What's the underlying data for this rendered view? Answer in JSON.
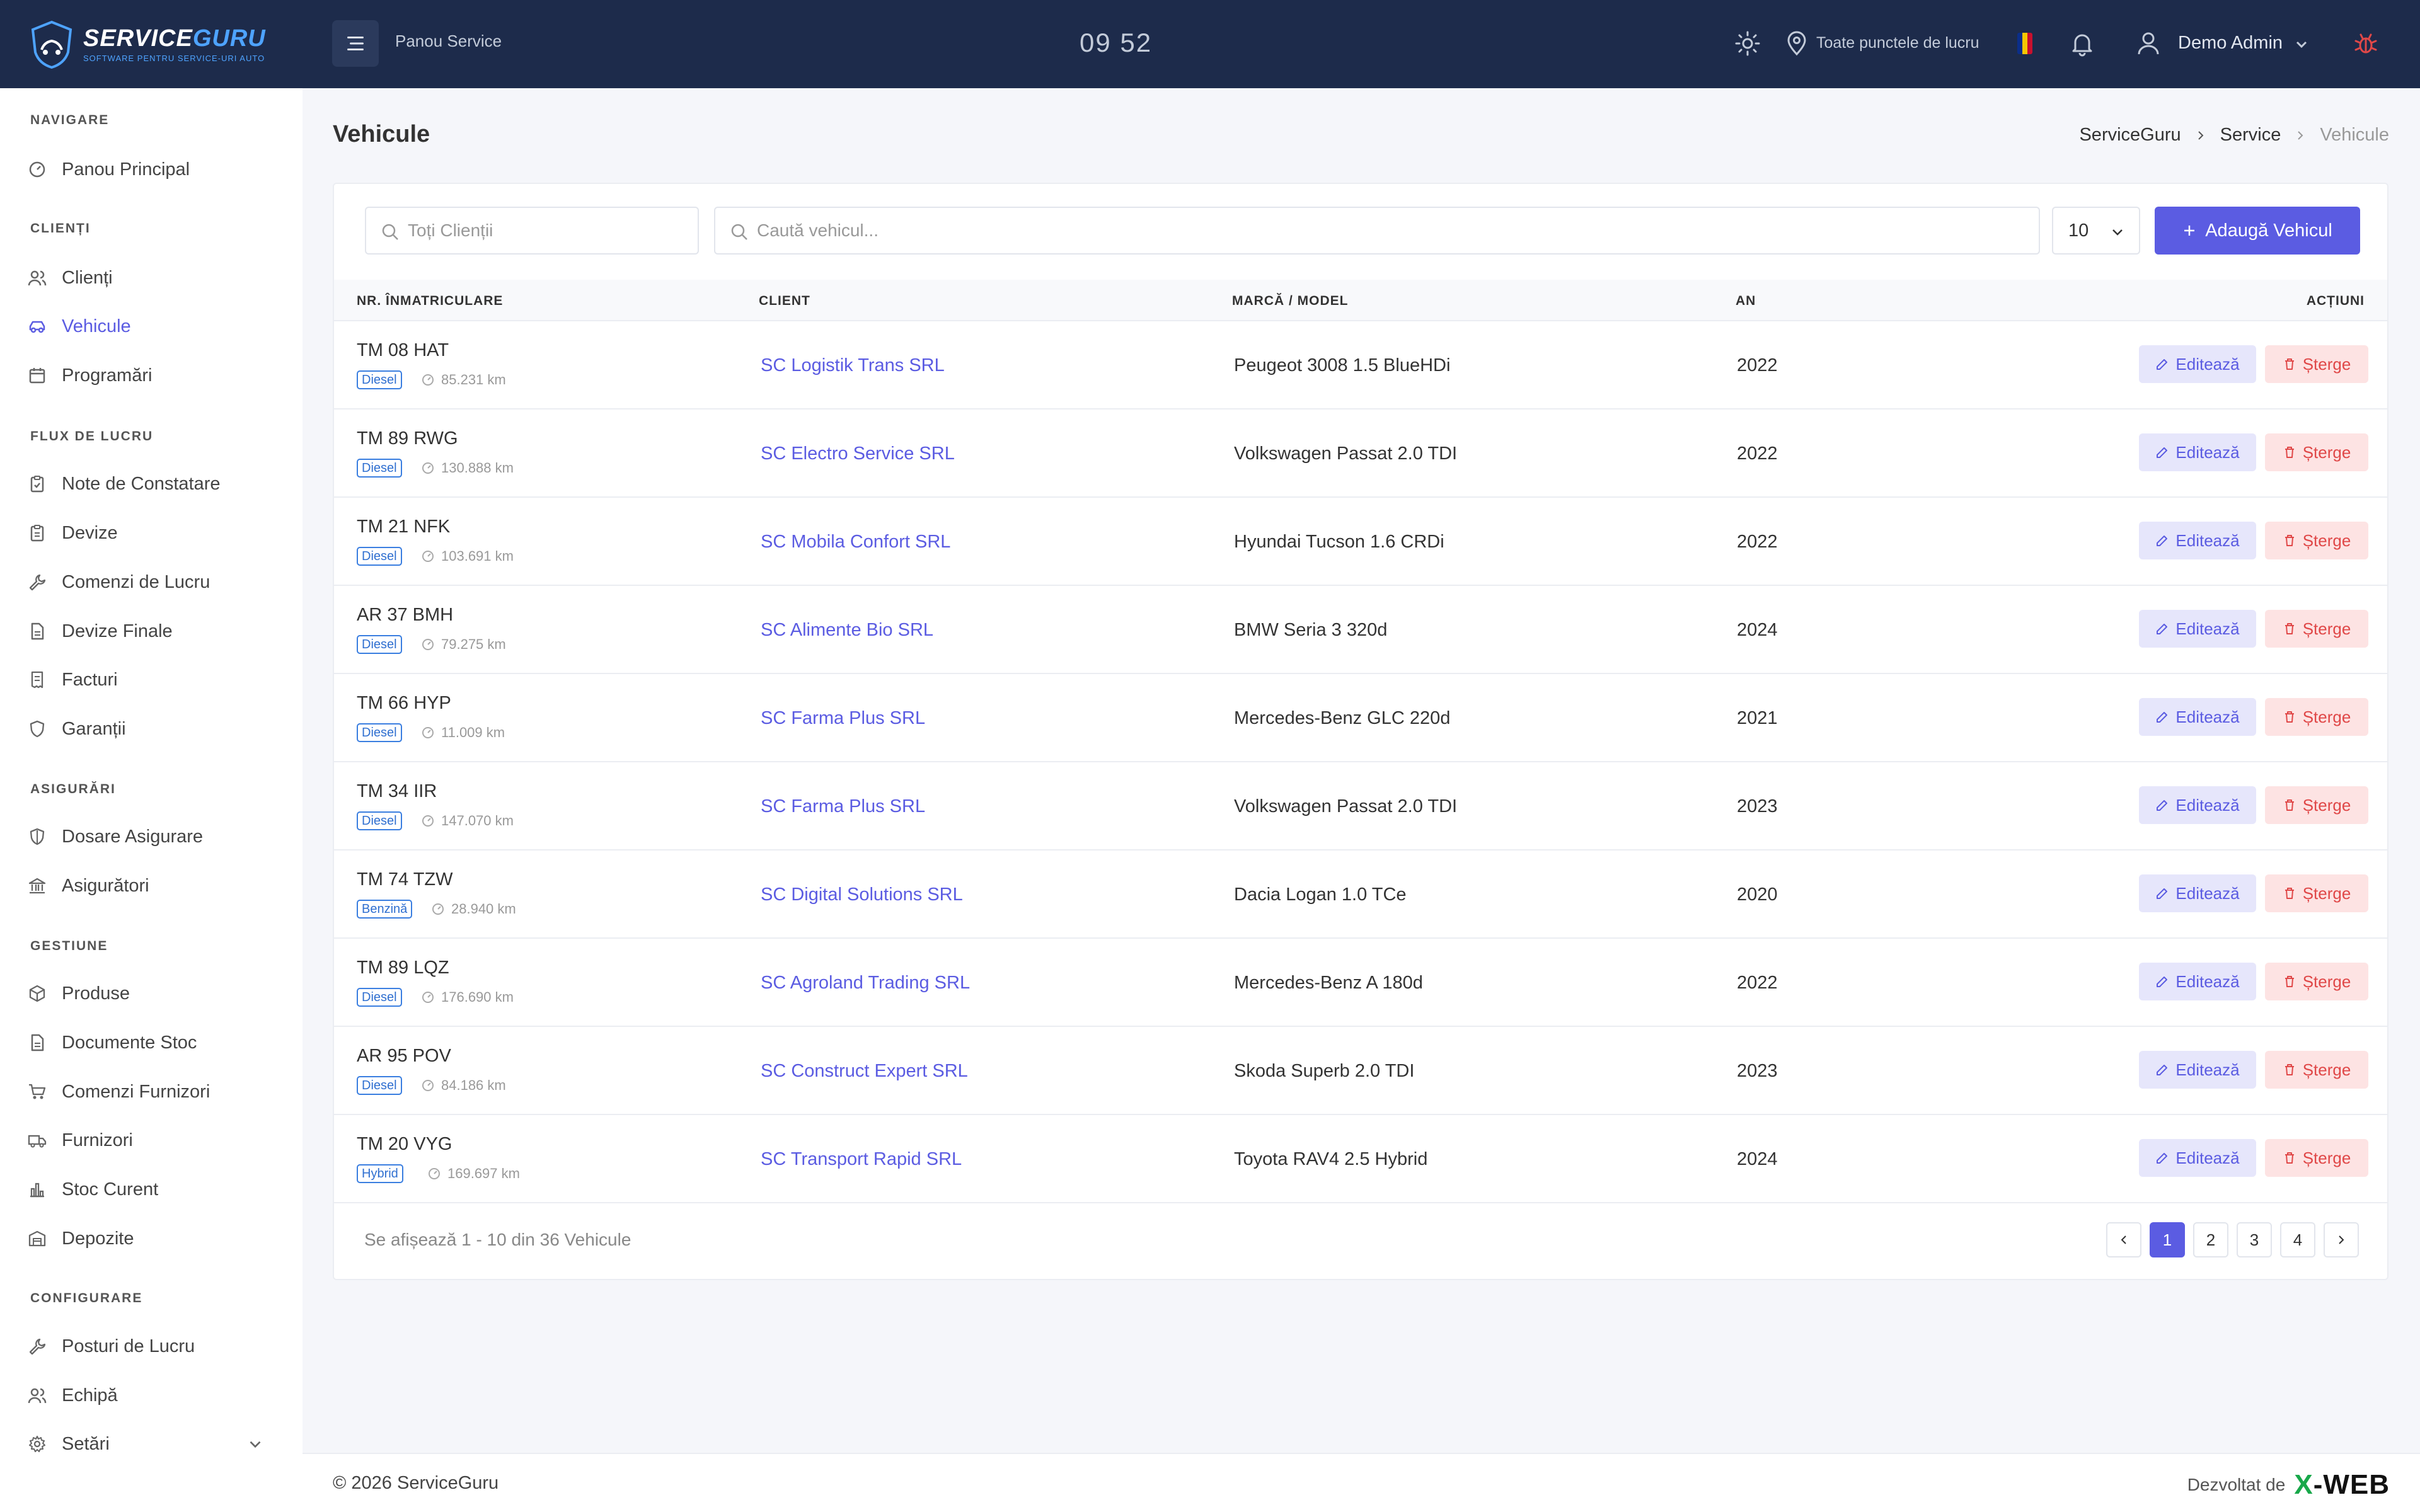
{
  "app": {
    "logo_title_a": "SERVICE",
    "logo_title_b": "GURU",
    "logo_subtitle": "SOFTWARE PENTRU SERVICE-URI AUTO"
  },
  "topbar": {
    "title": "Panou Service",
    "clock": "09 52",
    "location": "Toate punctele de lucru",
    "user": "Demo Admin"
  },
  "sidebar": {
    "sections": [
      {
        "label": "NAVIGARE",
        "items": [
          {
            "label": "Panou Principal",
            "icon": "dashboard-icon"
          }
        ]
      },
      {
        "label": "CLIENȚI",
        "items": [
          {
            "label": "Clienți",
            "icon": "users-icon"
          },
          {
            "label": "Vehicule",
            "icon": "car-icon"
          },
          {
            "label": "Programări",
            "icon": "calendar-icon"
          }
        ]
      },
      {
        "label": "FLUX DE LUCRU",
        "items": [
          {
            "label": "Note de Constatare",
            "icon": "clipboard-icon"
          },
          {
            "label": "Devize",
            "icon": "clipboard-list-icon"
          },
          {
            "label": "Comenzi de Lucru",
            "icon": "wrench-icon"
          },
          {
            "label": "Devize Finale",
            "icon": "file-icon"
          },
          {
            "label": "Facturi",
            "icon": "receipt-icon"
          },
          {
            "label": "Garanții",
            "icon": "shield-check-icon"
          }
        ]
      },
      {
        "label": "ASIGURĂRI",
        "items": [
          {
            "label": "Dosare Asigurare",
            "icon": "shield-icon"
          },
          {
            "label": "Asigurători",
            "icon": "bank-icon"
          }
        ]
      },
      {
        "label": "GESTIUNE",
        "items": [
          {
            "label": "Produse",
            "icon": "box-icon"
          },
          {
            "label": "Documente Stoc",
            "icon": "document-icon"
          },
          {
            "label": "Comenzi Furnizori",
            "icon": "cart-icon"
          },
          {
            "label": "Furnizori",
            "icon": "truck-icon"
          },
          {
            "label": "Stoc Curent",
            "icon": "bar-chart-icon"
          },
          {
            "label": "Depozite",
            "icon": "warehouse-icon"
          }
        ]
      },
      {
        "label": "CONFIGURARE",
        "items": [
          {
            "label": "Posturi de Lucru",
            "icon": "wrench-icon"
          },
          {
            "label": "Echipă",
            "icon": "team-icon"
          },
          {
            "label": "Setări",
            "icon": "gear-icon"
          }
        ]
      }
    ]
  },
  "page": {
    "title": "Vehicule",
    "breadcrumb": [
      "ServiceGuru",
      "Service",
      "Vehicule"
    ]
  },
  "filters": {
    "client_placeholder": "Toți Clienții",
    "search_placeholder": "Caută vehicul...",
    "page_size": "10",
    "add_label": "Adaugă Vehicul"
  },
  "table": {
    "headers": {
      "plate": "NR. ÎNMATRICULARE",
      "client": "CLIENT",
      "model": "MARCĂ / MODEL",
      "year": "AN",
      "actions": "ACȚIUNI"
    },
    "edit_label": "Editează",
    "delete_label": "Șterge",
    "rows": [
      {
        "plate": "TM 08 HAT",
        "fuel": "Diesel",
        "km": "85.231 km",
        "client": "SC Logistik Trans SRL",
        "model": "Peugeot 3008 1.5 BlueHDi",
        "year": "2022"
      },
      {
        "plate": "TM 89 RWG",
        "fuel": "Diesel",
        "km": "130.888 km",
        "client": "SC Electro Service SRL",
        "model": "Volkswagen Passat 2.0 TDI",
        "year": "2022"
      },
      {
        "plate": "TM 21 NFK",
        "fuel": "Diesel",
        "km": "103.691 km",
        "client": "SC Mobila Confort SRL",
        "model": "Hyundai Tucson 1.6 CRDi",
        "year": "2022"
      },
      {
        "plate": "AR 37 BMH",
        "fuel": "Diesel",
        "km": "79.275 km",
        "client": "SC Alimente Bio SRL",
        "model": "BMW Seria 3 320d",
        "year": "2024"
      },
      {
        "plate": "TM 66 HYP",
        "fuel": "Diesel",
        "km": "11.009 km",
        "client": "SC Farma Plus SRL",
        "model": "Mercedes-Benz GLC 220d",
        "year": "2021"
      },
      {
        "plate": "TM 34 IIR",
        "fuel": "Diesel",
        "km": "147.070 km",
        "client": "SC Farma Plus SRL",
        "model": "Volkswagen Passat 2.0 TDI",
        "year": "2023"
      },
      {
        "plate": "TM 74 TZW",
        "fuel": "Benzină",
        "km": "28.940 km",
        "client": "SC Digital Solutions SRL",
        "model": "Dacia Logan 1.0 TCe",
        "year": "2020"
      },
      {
        "plate": "TM 89 LQZ",
        "fuel": "Diesel",
        "km": "176.690 km",
        "client": "SC Agroland Trading SRL",
        "model": "Mercedes-Benz A 180d",
        "year": "2022"
      },
      {
        "plate": "AR 95 POV",
        "fuel": "Diesel",
        "km": "84.186 km",
        "client": "SC Construct Expert SRL",
        "model": "Skoda Superb 2.0 TDI",
        "year": "2023"
      },
      {
        "plate": "TM 20 VYG",
        "fuel": "Hybrid",
        "km": "169.697 km",
        "client": "SC Transport Rapid SRL",
        "model": "Toyota RAV4 2.5 Hybrid",
        "year": "2024"
      }
    ]
  },
  "pagination": {
    "summary": "Se afișează 1 - 10 din 36 Vehicule",
    "pages": [
      "1",
      "2",
      "3",
      "4"
    ],
    "current": "1"
  },
  "footer": {
    "copyright": "© 2026 ServiceGuru",
    "developed_by": "Dezvoltat de",
    "brand_x": "X",
    "brand_rest": "-WEB"
  },
  "colors": {
    "accent": "#5b5ce2",
    "topbar": "#1d2b4b",
    "danger": "#e04848",
    "fuel_badge": "#3a7ee0"
  }
}
